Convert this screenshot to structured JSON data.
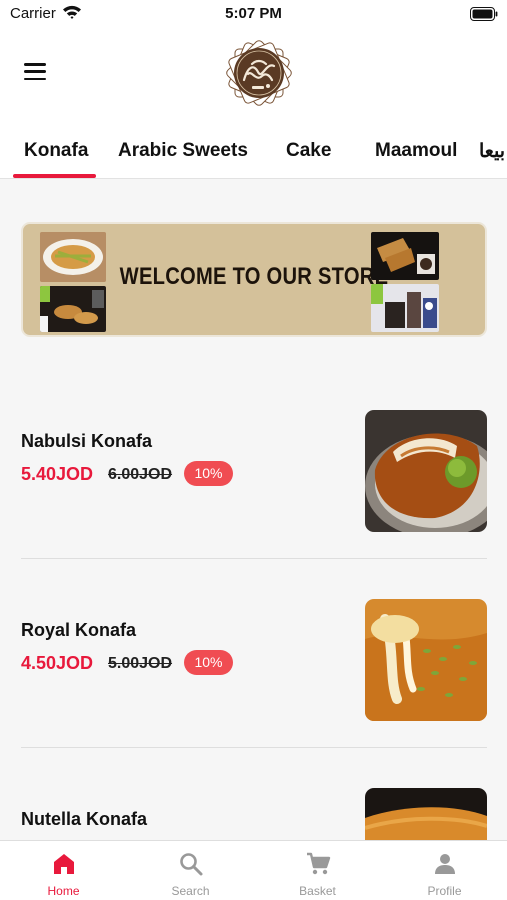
{
  "status_bar": {
    "carrier": "Carrier",
    "time": "5:07 PM"
  },
  "header": {
    "logo_icon": "bakery-logo",
    "menu_icon": "hamburger-menu-icon"
  },
  "tabs": [
    {
      "label": "Konafa",
      "active": true
    },
    {
      "label": "Arabic Sweets",
      "active": false
    },
    {
      "label": "Cake",
      "active": false
    },
    {
      "label": "Maamoul",
      "active": false
    },
    {
      "label": "بيعا",
      "active": false
    }
  ],
  "banner": {
    "text": "WELCOME TO OUR STORE"
  },
  "products": [
    {
      "name": "Nabulsi Konafa",
      "price": "5.40JOD",
      "old_price": "6.00JOD",
      "discount": "10%"
    },
    {
      "name": "Royal Konafa",
      "price": "4.50JOD",
      "old_price": "5.00JOD",
      "discount": "10%"
    },
    {
      "name": "Nutella Konafa"
    }
  ],
  "bottom_nav": [
    {
      "label": "Home",
      "icon": "home-icon",
      "active": true
    },
    {
      "label": "Search",
      "icon": "search-icon",
      "active": false
    },
    {
      "label": "Basket",
      "icon": "cart-icon",
      "active": false
    },
    {
      "label": "Profile",
      "icon": "person-icon",
      "active": false
    }
  ],
  "colors": {
    "accent": "#e8193c",
    "discount_badge": "#f04c52",
    "banner_bg": "#d4c19a",
    "logo_brown": "#5a3a24"
  }
}
